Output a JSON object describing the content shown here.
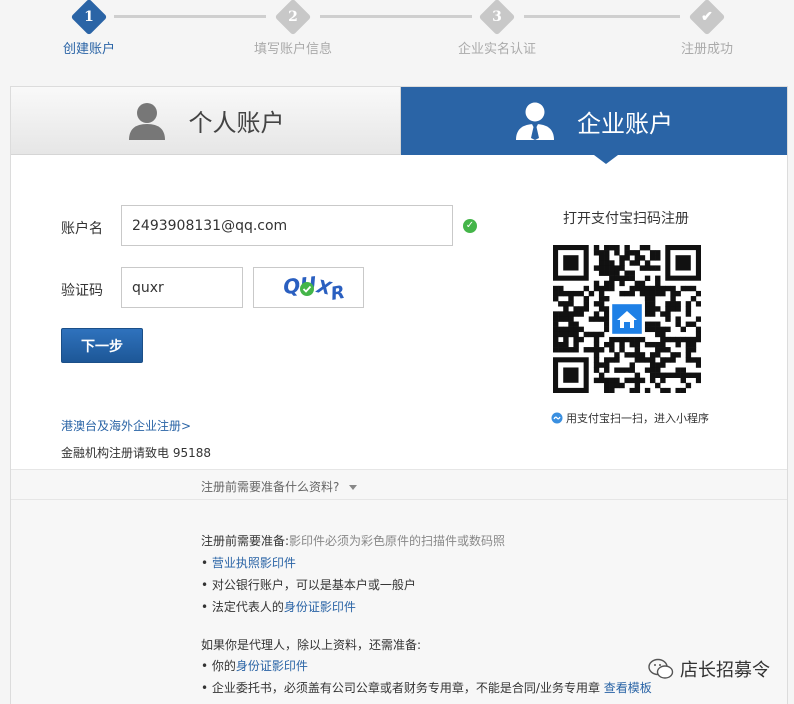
{
  "steps": [
    {
      "num": "1",
      "label": "创建账户"
    },
    {
      "num": "2",
      "label": "填写账户信息"
    },
    {
      "num": "3",
      "label": "企业实名认证"
    },
    {
      "num": "✔",
      "label": "注册成功"
    }
  ],
  "tabs": {
    "personal": "个人账户",
    "enterprise": "企业账户"
  },
  "form": {
    "account_label": "账户名",
    "account_value": "2493908131@qq.com",
    "captcha_label": "验证码",
    "captcha_value": "quxr",
    "captcha_image_text": "QUXR",
    "next_button": "下一步"
  },
  "links": {
    "overseas": "港澳台及海外企业注册>",
    "finance_note": "金融机构注册请致电 95188"
  },
  "qr": {
    "title": "打开支付宝扫码注册",
    "hint": "用支付宝扫一扫，进入小程序"
  },
  "requirements": {
    "toggle": "注册前需要准备什么资料?",
    "intro": "注册前需要准备:",
    "intro_note": "影印件必须为彩色原件的扫描件或数码照",
    "items": [
      "营业执照影印件",
      "对公银行账户，可以是基本户或一般户",
      "法定代表人的",
      "身份证影印件"
    ],
    "agent_intro": "如果你是代理人，除以上资料，还需准备:",
    "agent_items": [
      "你的",
      "身份证影印件",
      "企业委托书，必须盖有公司公章或者财务专用章，不能是合同/业务专用章",
      "查看模板"
    ]
  },
  "watermark": "店长招募令",
  "colors": {
    "brand_blue": "#2a64a6",
    "success_green": "#44b549"
  }
}
